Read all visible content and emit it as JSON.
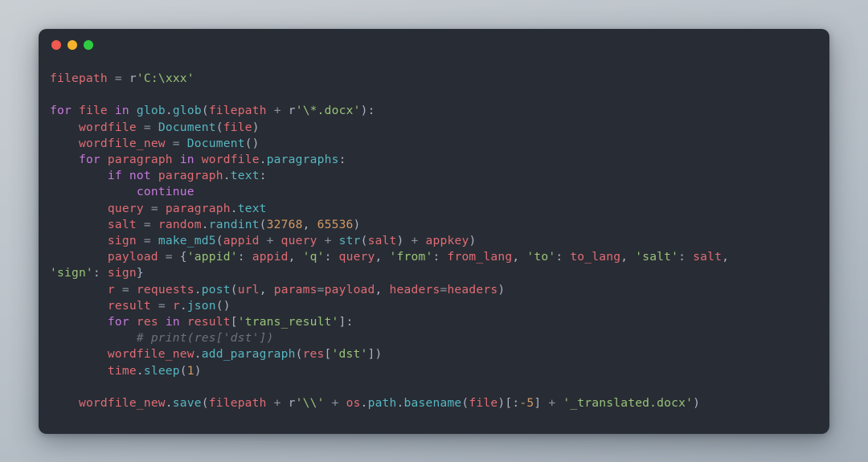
{
  "window": {
    "controls": [
      {
        "name": "close",
        "label": "close",
        "color": "#f05a50"
      },
      {
        "name": "minimize",
        "label": "minimize",
        "color": "#f5b32b"
      },
      {
        "name": "maximize",
        "label": "maximize",
        "color": "#2ecc40"
      }
    ],
    "background_color": "#282c34"
  },
  "theme": {
    "keyword": "#c678dd",
    "variable": "#e06c75",
    "function": "#56b6c2",
    "string": "#98c379",
    "number": "#d19a66",
    "comment": "#6b727d",
    "plain": "#abb2bf",
    "operator": "#8a93a1"
  },
  "code": {
    "language": "python",
    "lines": [
      "filepath = r'C:\\xxx'",
      "",
      "for file in glob.glob(filepath + r'\\*.docx'):",
      "    wordfile = Document(file)",
      "    wordfile_new = Document()",
      "    for paragraph in wordfile.paragraphs:",
      "        if not paragraph.text:",
      "            continue",
      "        query = paragraph.text",
      "        salt = random.randint(32768, 65536)",
      "        sign = make_md5(appid + query + str(salt) + appkey)",
      "        payload = {'appid': appid, 'q': query, 'from': from_lang, 'to': to_lang, 'salt': salt, 'sign': sign}",
      "        r = requests.post(url, params=payload, headers=headers)",
      "        result = r.json()",
      "        for res in result['trans_result']:",
      "            # print(res['dst'])",
      "        wordfile_new.add_paragraph(res['dst'])",
      "        time.sleep(1)",
      "",
      "    wordfile_new.save(filepath + r'\\\\' + os.path.basename(file)[:-5] + '_translated.docx')"
    ]
  }
}
